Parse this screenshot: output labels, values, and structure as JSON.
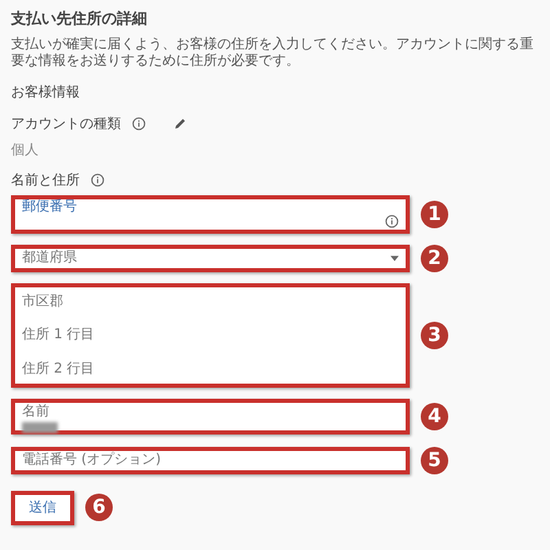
{
  "title": "支払い先住所の詳細",
  "description": "支払いが確実に届くよう、お客様の住所を入力してください。アカウントに関する重要な情報をお送りするために住所が必要です。",
  "section_label": "お客様情報",
  "account_type": {
    "label": "アカウントの種類",
    "value": "個人"
  },
  "address_heading": "名前と住所",
  "fields": [
    {
      "kind": "zip",
      "label": "郵便番号",
      "callout": "1"
    },
    {
      "kind": "select",
      "placeholder": "都道府県",
      "callout": "2"
    },
    {
      "kind": "address",
      "lines": [
        "市区郡",
        "住所 1 行目",
        "住所 2 行目"
      ],
      "callout": "3"
    },
    {
      "kind": "filled",
      "label": "名前",
      "callout": "4"
    },
    {
      "kind": "text",
      "placeholder": "電話番号 (オプション)",
      "callout": "5"
    }
  ],
  "submit": {
    "label": "送信",
    "callout": "6"
  }
}
